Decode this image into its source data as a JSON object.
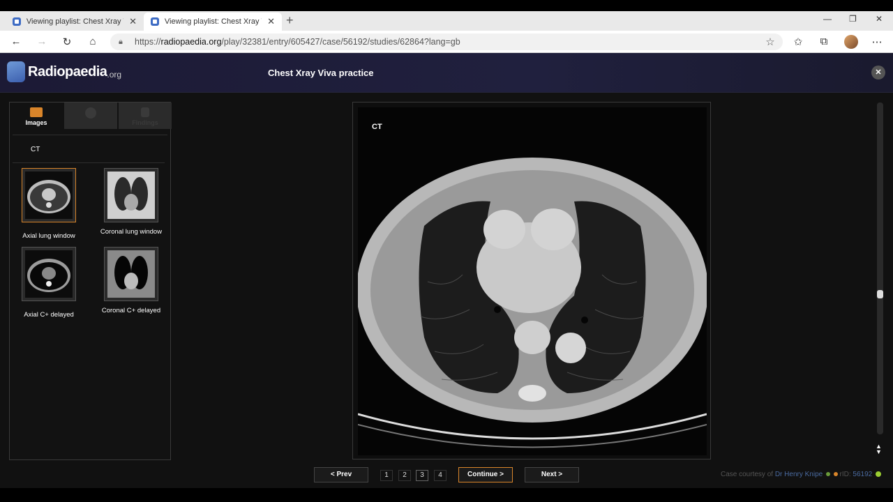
{
  "browser": {
    "tabs": [
      {
        "title": "Viewing playlist: Chest Xray Viva"
      },
      {
        "title": "Viewing playlist: Chest Xray Viva"
      }
    ],
    "url_domain": "radiopaedia.org",
    "url_prefix": "https://",
    "url_path": "/play/32381/entry/605427/case/56192/studies/62864?lang=gb"
  },
  "app": {
    "logo_name": "Radiopaedia",
    "logo_suffix": ".org",
    "title": "Chest Xray Viva practice"
  },
  "panel": {
    "tabs": [
      {
        "label": "Images"
      },
      {
        "label": ""
      },
      {
        "label": "Findings"
      }
    ],
    "modality": "CT",
    "series": [
      {
        "label": "Axial lung window"
      },
      {
        "label": "Coronal lung window"
      },
      {
        "label": "Axial C+ delayed"
      },
      {
        "label": "Coronal C+ delayed"
      }
    ]
  },
  "viewer": {
    "modality_label": "CT"
  },
  "navigation": {
    "prev": "<  Prev",
    "continue": "Continue  >",
    "next": "Next  >",
    "pages": [
      "1",
      "2",
      "3",
      "4"
    ],
    "current_page": "3"
  },
  "credit": {
    "prefix": "Case courtesy of",
    "author": "Dr Henry Knipe",
    "rid_label": "rID:",
    "rid": "56192"
  },
  "colors": {
    "accent": "#d9852a",
    "header_bg": "#1c1a35"
  }
}
